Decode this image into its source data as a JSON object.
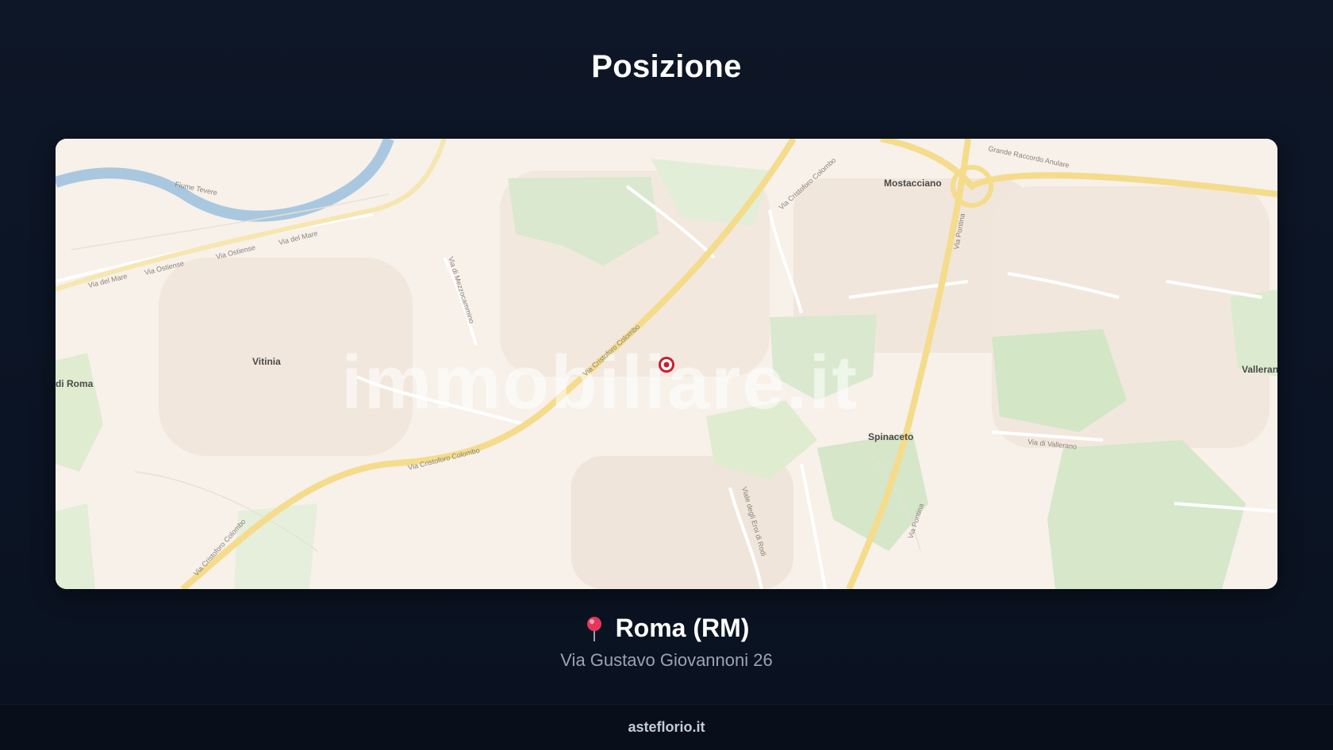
{
  "section": {
    "title": "Posizione"
  },
  "map": {
    "watermark": "immobiliare.it",
    "places": {
      "vitinia": "Vitinia",
      "mostacciano": "Mostacciano",
      "spinaceto": "Spinaceto",
      "vallerano": "Valleran",
      "di_roma": "di Roma"
    },
    "roads": {
      "ostiense_a": "Via Ostiense",
      "ostiense_b": "Via Ostiense",
      "del_mare_a": "Via del Mare",
      "del_mare_b": "Via del Mare",
      "colombo_a": "Via Cristoforo Colombo",
      "colombo_b": "Via Cristoforo Colombo",
      "colombo_c": "Via Cristoforo Colombo",
      "colombo_d": "Via Cristoforo Colombo",
      "pontina_a": "Via Pontina",
      "pontina_b": "Via Pontina",
      "raccordo": "Grande Raccordo Anulare",
      "mezzocammino": "Via di Mezzocammino",
      "fiori": "Viale degli Eroi di Rodi",
      "vallerano": "Via di Vallerano",
      "tevere": "Fiume Tevere"
    },
    "marker_icon": "map-marker-icon"
  },
  "location": {
    "pin_icon": "red-pin-icon",
    "city": "Roma (RM)",
    "address": "Via Gustavo Giovannoni 26"
  },
  "footer": {
    "text": "asteflorio.it"
  },
  "colors": {
    "background": "#0e1727",
    "map_base": "#f7f1ea",
    "park": "#d9e8cf",
    "main_road": "#f4dc8c",
    "river": "#a9c8e0",
    "marker": "#c81e2d"
  }
}
